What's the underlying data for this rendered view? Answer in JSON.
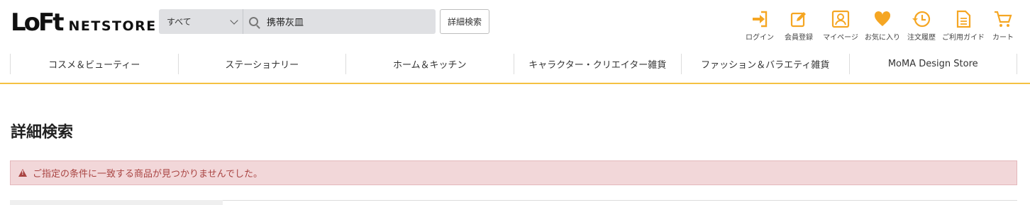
{
  "brand": {
    "mark": "LoFt",
    "name": "NETSTORE",
    "accent": "#f5a623"
  },
  "search": {
    "scope": "すべて",
    "query": "携帯灰皿",
    "advanced_label": "詳細検索"
  },
  "utility_nav": [
    {
      "label": "ログイン",
      "icon": "login-icon"
    },
    {
      "label": "会員登録",
      "icon": "edit-icon"
    },
    {
      "label": "マイページ",
      "icon": "user-icon"
    },
    {
      "label": "お気に入り",
      "icon": "heart-icon"
    },
    {
      "label": "注文履歴",
      "icon": "history-icon"
    },
    {
      "label": "ご利用ガイド",
      "icon": "document-icon"
    },
    {
      "label": "カート",
      "icon": "cart-icon"
    }
  ],
  "categories": [
    "コスメ＆ビューティー",
    "ステーショナリー",
    "ホーム＆キッチン",
    "キャラクター・クリエイター雑貨",
    "ファッション＆バラエティ雑貨",
    "MoMA Design Store"
  ],
  "page": {
    "title": "詳細検索",
    "alert_message": "ご指定の条件に一致する商品が見つかりませんでした。"
  }
}
